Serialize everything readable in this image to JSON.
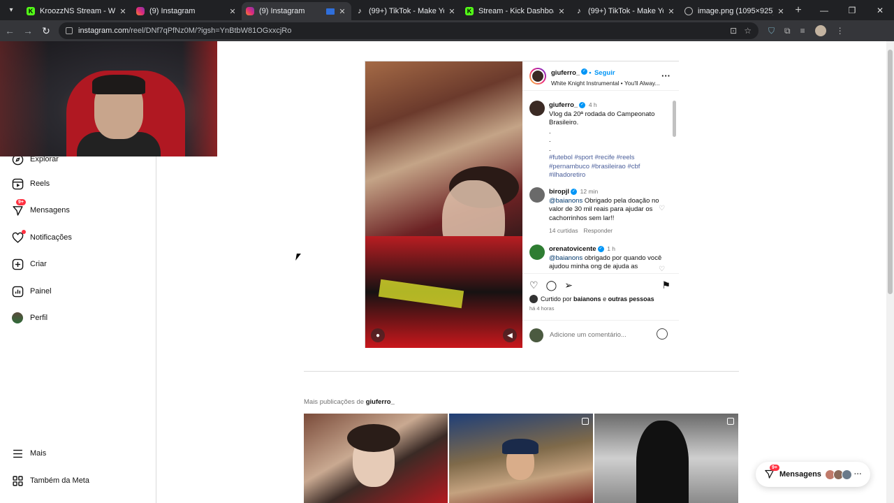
{
  "browser": {
    "tabs": [
      {
        "title": "KroozzNS Stream - Watch Live",
        "favicon": "kick-icon",
        "active": false
      },
      {
        "title": "(9) Instagram",
        "favicon": "instagram-icon",
        "active": false
      },
      {
        "title": "(9) Instagram",
        "favicon": "instagram-icon",
        "active": true
      },
      {
        "title": "(99+) TikTok - Make Your Day",
        "favicon": "tiktok-icon",
        "active": false
      },
      {
        "title": "Stream - Kick Dashboard",
        "favicon": "kick-icon",
        "active": false
      },
      {
        "title": "(99+) TikTok - Make Your Day",
        "favicon": "tiktok-icon",
        "active": false
      },
      {
        "title": "image.png (1095×925)",
        "favicon": "globe-icon",
        "active": false
      }
    ],
    "url_domain": "instagram.com",
    "url_path": "/reel/DNf7qPfNz0M/?igsh=YnBtbW81OGxxcjRo"
  },
  "sidebar": {
    "items": [
      {
        "label": "Explorar",
        "icon": "compass-icon"
      },
      {
        "label": "Reels",
        "icon": "reels-icon"
      },
      {
        "label": "Mensagens",
        "icon": "messenger-icon",
        "badge": "9+"
      },
      {
        "label": "Notificações",
        "icon": "heart-icon",
        "dot": true
      },
      {
        "label": "Criar",
        "icon": "plus-square-icon"
      },
      {
        "label": "Painel",
        "icon": "chart-icon"
      },
      {
        "label": "Perfil",
        "icon": "avatar-icon"
      }
    ],
    "bottom": [
      {
        "label": "Mais",
        "icon": "menu-icon"
      },
      {
        "label": "Também da Meta",
        "icon": "meta-grid-icon"
      }
    ]
  },
  "post": {
    "author": "giuferro_",
    "follow_separator": "•",
    "follow_label": "Seguir",
    "audio": "White Knight Instrumental • You'll Alway...",
    "caption": {
      "user": "giuferro_",
      "time": "4 h",
      "lines": [
        "Vlog da 20ª rodada do Campeonato Brasileiro.",
        ".",
        ".",
        "."
      ],
      "hashtags": "#futebol #sport #recife #reels #pernambuco #brasileirao #cbf #ilhadoretiro"
    },
    "comments": [
      {
        "user": "biropjl",
        "time": "12 min",
        "mention": "@baianons",
        "text": "Obrigado pela doação no valor de 30 mil reais para ajudar os cachorrinhos sem lar!!",
        "likes": "14 curtidas",
        "reply": "Responder"
      },
      {
        "user": "orenatovicente",
        "time": "1 h",
        "mention": "@baianons",
        "text": "obrigado por quando você ajudou minha ong de ajuda as"
      }
    ],
    "liked_prefix": "Curtido por",
    "liked_user": "baianons",
    "liked_and": "e",
    "liked_others": "outras pessoas",
    "posted": "há 4 horas",
    "add_comment_placeholder": "Adicione um comentário..."
  },
  "more": {
    "prefix": "Mais publicações de",
    "user": "giuferro_"
  },
  "messages_pill": {
    "label": "Mensagens",
    "badge": "9+"
  }
}
